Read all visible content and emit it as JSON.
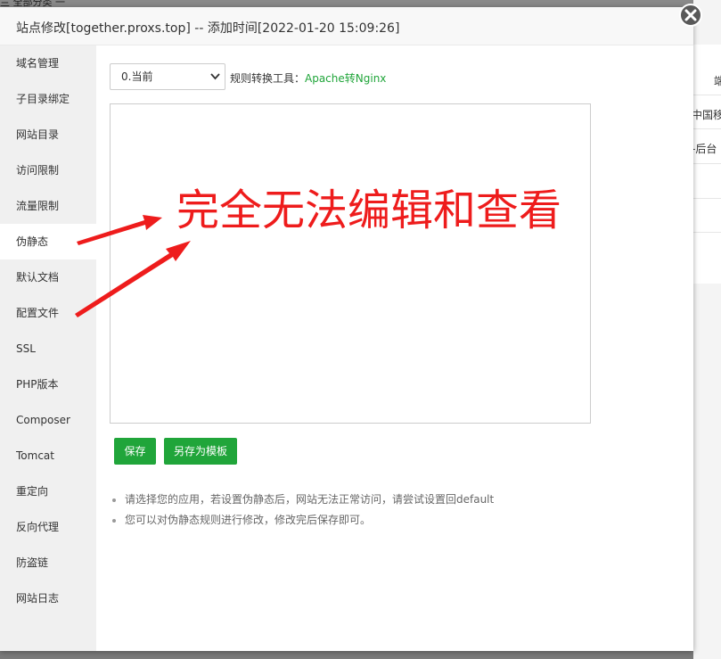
{
  "background": {
    "top_text": "兰  全部分类  一",
    "row_texts": [
      "端",
      "中国移",
      "-后台"
    ]
  },
  "dialog": {
    "title": "站点修改[together.proxs.top] -- 添加时间[2022-01-20 15:09:26]",
    "close_icon": "close-icon"
  },
  "sidebar": {
    "items": [
      {
        "label": "域名管理"
      },
      {
        "label": "子目录绑定"
      },
      {
        "label": "网站目录"
      },
      {
        "label": "访问限制"
      },
      {
        "label": "流量限制"
      },
      {
        "label": "伪静态",
        "active": true
      },
      {
        "label": "默认文档"
      },
      {
        "label": "配置文件"
      },
      {
        "label": "SSL"
      },
      {
        "label": "PHP版本"
      },
      {
        "label": "Composer"
      },
      {
        "label": "Tomcat"
      },
      {
        "label": "重定向"
      },
      {
        "label": "反向代理"
      },
      {
        "label": "防盗链"
      },
      {
        "label": "网站日志"
      }
    ]
  },
  "rewrite": {
    "select_value": "0.当前",
    "tool_label": "规则转换工具：",
    "tool_link": "Apache转Nginx",
    "editor_value": "",
    "save_label": "保存",
    "save_template_label": "另存为模板",
    "tips": [
      "请选择您的应用，若设置伪静态后，网站无法正常访问，请尝试设置回default",
      "您可以对伪静态规则进行修改，修改完后保存即可。"
    ]
  },
  "annotation": {
    "text": "完全无法编辑和查看"
  },
  "colors": {
    "accent": "#20a53a",
    "annotation": "#ee1c1c"
  }
}
